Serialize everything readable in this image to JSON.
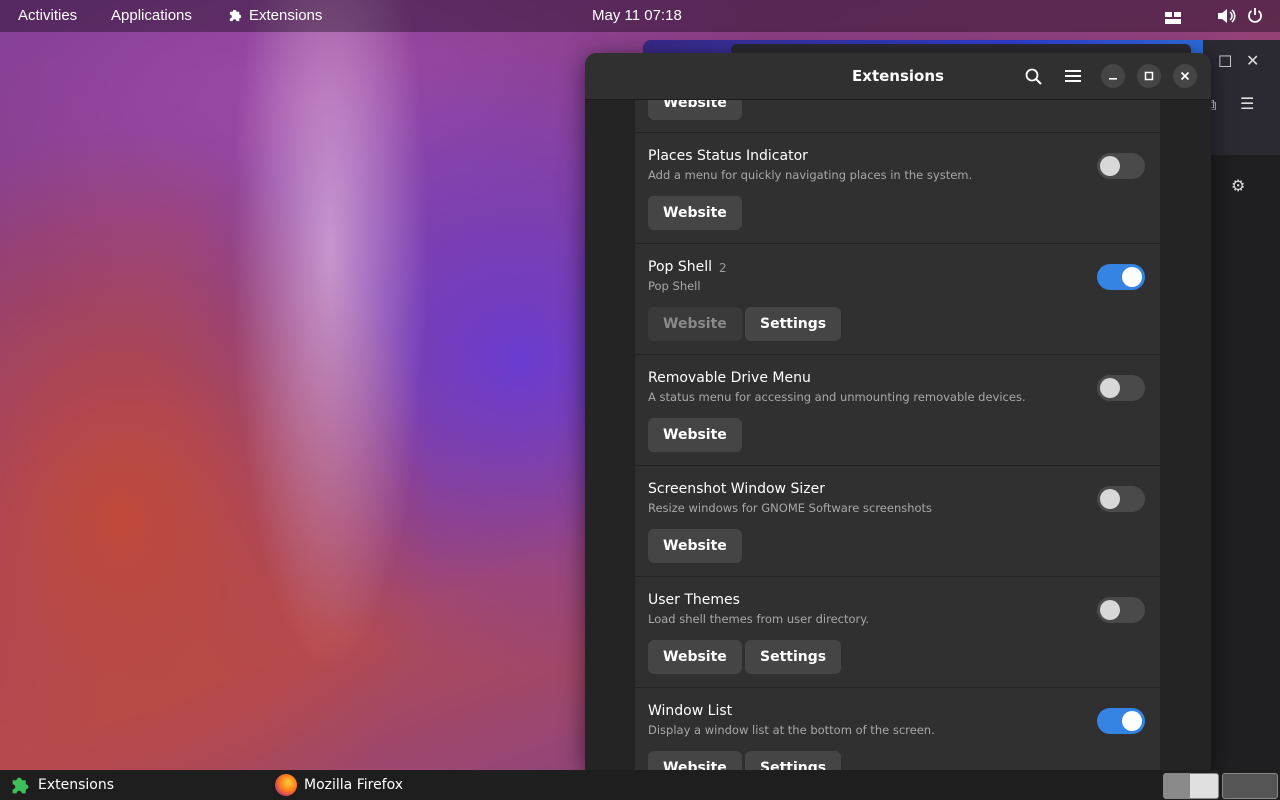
{
  "topbar": {
    "activities": "Activities",
    "applications": "Applications",
    "app_name": "Extensions",
    "datetime": "May 11  07:18"
  },
  "window": {
    "title": "Extensions",
    "extensions": [
      {
        "name": "",
        "version": "",
        "description": "",
        "enabled": false,
        "buttons": [
          {
            "label": "Website",
            "disabled": false
          }
        ]
      },
      {
        "name": "Places Status Indicator",
        "version": "",
        "description": "Add a menu for quickly navigating places in the system.",
        "enabled": false,
        "buttons": [
          {
            "label": "Website",
            "disabled": false
          }
        ]
      },
      {
        "name": "Pop Shell",
        "version": "2",
        "description": "Pop Shell",
        "enabled": true,
        "buttons": [
          {
            "label": "Website",
            "disabled": true
          },
          {
            "label": "Settings",
            "disabled": false
          }
        ]
      },
      {
        "name": "Removable Drive Menu",
        "version": "",
        "description": "A status menu for accessing and unmounting removable devices.",
        "enabled": false,
        "buttons": [
          {
            "label": "Website",
            "disabled": false
          }
        ]
      },
      {
        "name": "Screenshot Window Sizer",
        "version": "",
        "description": "Resize windows for GNOME Software screenshots",
        "enabled": false,
        "buttons": [
          {
            "label": "Website",
            "disabled": false
          }
        ]
      },
      {
        "name": "User Themes",
        "version": "",
        "description": "Load shell themes from user directory.",
        "enabled": false,
        "buttons": [
          {
            "label": "Website",
            "disabled": false
          },
          {
            "label": "Settings",
            "disabled": false
          }
        ]
      },
      {
        "name": "Window List",
        "version": "",
        "description": "Display a window list at the bottom of the screen.",
        "enabled": true,
        "buttons": [
          {
            "label": "Website",
            "disabled": false
          },
          {
            "label": "Settings",
            "disabled": false
          }
        ]
      }
    ]
  },
  "taskbar": {
    "tasks": [
      {
        "label": "Extensions",
        "icon": "puzzle-icon"
      },
      {
        "label": "Mozilla Firefox",
        "icon": "firefox-icon"
      }
    ]
  },
  "colors": {
    "accent": "#3584e4",
    "row_bg": "#303030",
    "window_bg": "#242424"
  }
}
